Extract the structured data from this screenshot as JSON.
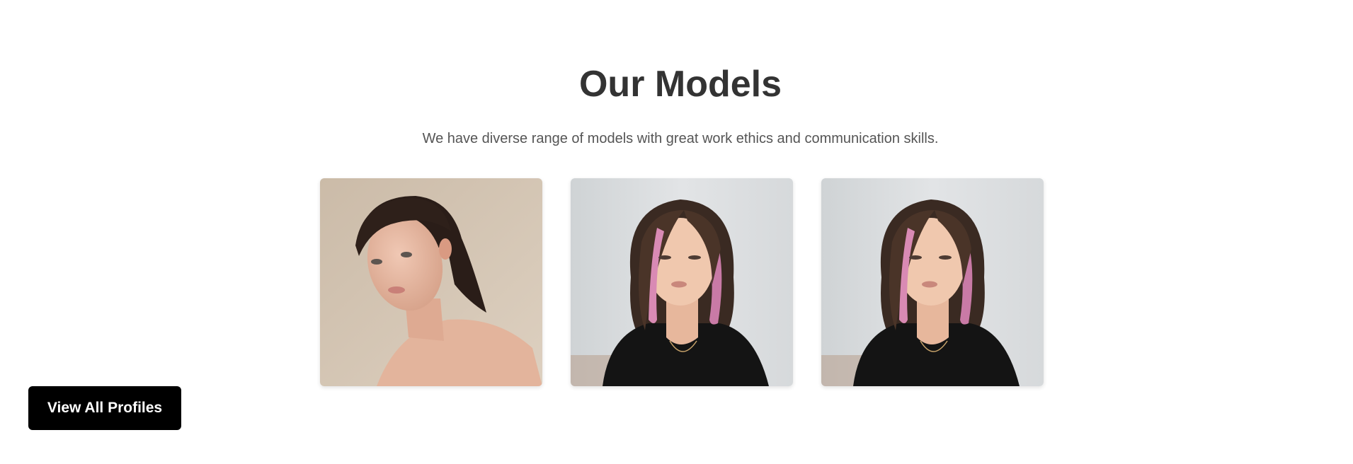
{
  "section": {
    "title": "Our Models",
    "subtitle": "We have diverse range of models with great work ethics and communication skills."
  },
  "models": [
    {
      "photo": "portrait-photo",
      "bg_color": "#d4c5b5"
    },
    {
      "photo": "portrait-photo",
      "bg_color": "#dde0e2"
    },
    {
      "photo": "portrait-photo",
      "bg_color": "#dde0e2"
    }
  ],
  "actions": {
    "view_all_label": "View All Profiles"
  },
  "colors": {
    "title": "#333333",
    "subtitle": "#555555",
    "button_bg": "#000000",
    "button_text": "#ffffff"
  }
}
